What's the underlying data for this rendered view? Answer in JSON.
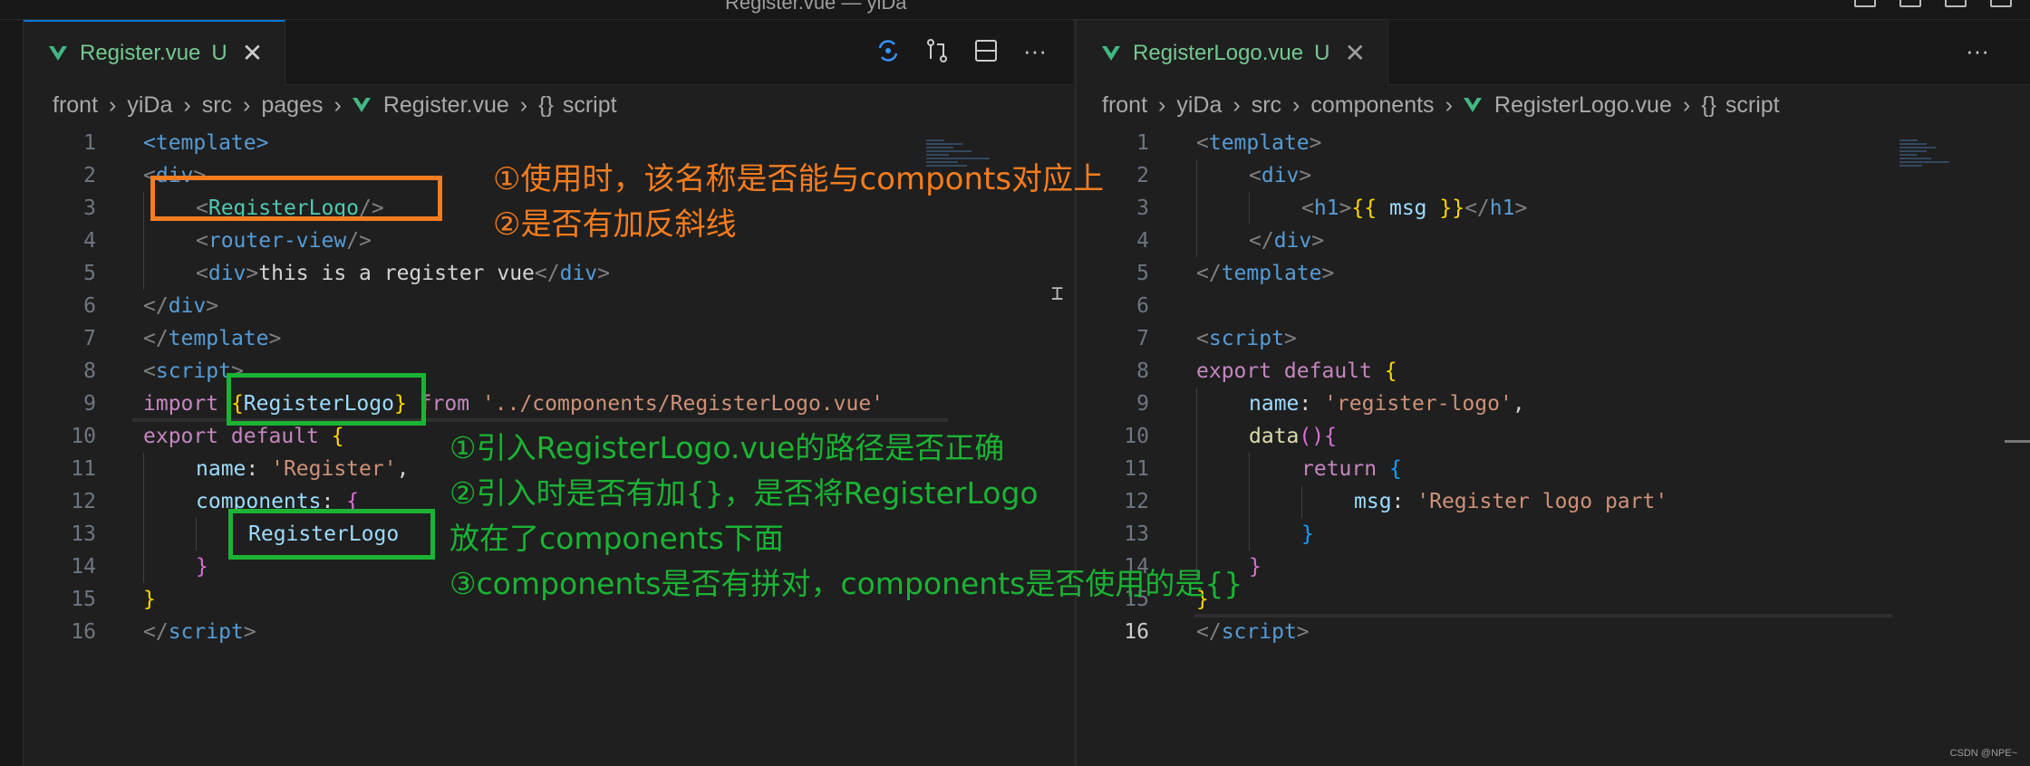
{
  "window": {
    "title": "Register.vue — yiDa"
  },
  "left": {
    "tab": {
      "name": "Register.vue",
      "status": "U"
    },
    "breadcrumb": [
      "front",
      "yiDa",
      "src",
      "pages",
      "Register.vue",
      "script"
    ],
    "toolbar": [
      "open-changes-icon",
      "compare-icon",
      "split-editor-icon",
      "more-actions-icon"
    ],
    "lines": [
      {
        "n": "1",
        "indent": 0,
        "t": [
          [
            "tag",
            "<template>"
          ]
        ]
      },
      {
        "n": "2",
        "indent": 0,
        "t": [
          [
            "pun",
            "<"
          ],
          [
            "tag",
            "div"
          ],
          [
            "pun",
            ">"
          ]
        ]
      },
      {
        "n": "3",
        "indent": 1,
        "t": [
          [
            "pun",
            "<"
          ],
          [
            "cmp",
            "RegisterLogo"
          ],
          [
            "pun",
            "/>"
          ]
        ]
      },
      {
        "n": "4",
        "indent": 1,
        "t": [
          [
            "pun",
            "<"
          ],
          [
            "tag",
            "router-view"
          ],
          [
            "pun",
            "/>"
          ]
        ]
      },
      {
        "n": "5",
        "indent": 1,
        "t": [
          [
            "pun",
            "<"
          ],
          [
            "tag",
            "div"
          ],
          [
            "pun",
            ">"
          ],
          [
            "plain",
            "this is a register vue"
          ],
          [
            "pun",
            "</"
          ],
          [
            "tag",
            "div"
          ],
          [
            "pun",
            ">"
          ]
        ]
      },
      {
        "n": "6",
        "indent": 0,
        "t": [
          [
            "pun",
            "</"
          ],
          [
            "tag",
            "div"
          ],
          [
            "pun",
            ">"
          ]
        ]
      },
      {
        "n": "7",
        "indent": 0,
        "t": [
          [
            "pun",
            "</"
          ],
          [
            "tag",
            "template"
          ],
          [
            "pun",
            ">"
          ]
        ]
      },
      {
        "n": "8",
        "indent": 0,
        "t": [
          [
            "pun",
            "<"
          ],
          [
            "tag",
            "script"
          ],
          [
            "pun",
            ">"
          ]
        ]
      },
      {
        "n": "9",
        "indent": 0,
        "t": [
          [
            "kw",
            "import "
          ],
          [
            "br1",
            "{"
          ],
          [
            "var",
            "RegisterLogo"
          ],
          [
            "br1",
            "}"
          ],
          [
            "kw",
            " from "
          ],
          [
            "str",
            "'../components/RegisterLogo.vue'"
          ]
        ]
      },
      {
        "n": "10",
        "indent": 0,
        "t": [
          [
            "kw",
            "export default "
          ],
          [
            "br1",
            "{"
          ]
        ]
      },
      {
        "n": "11",
        "indent": 1,
        "t": [
          [
            "var",
            "name"
          ],
          [
            "plain",
            ": "
          ],
          [
            "str",
            "'Register'"
          ],
          [
            "plain",
            ","
          ]
        ]
      },
      {
        "n": "12",
        "indent": 1,
        "t": [
          [
            "var",
            "components"
          ],
          [
            "plain",
            ": "
          ],
          [
            "br2",
            "{"
          ]
        ]
      },
      {
        "n": "13",
        "indent": 2,
        "t": [
          [
            "var",
            "RegisterLogo"
          ]
        ]
      },
      {
        "n": "14",
        "indent": 1,
        "t": [
          [
            "br2",
            "}"
          ]
        ]
      },
      {
        "n": "15",
        "indent": 0,
        "t": [
          [
            "br1",
            "}"
          ]
        ]
      },
      {
        "n": "16",
        "indent": 0,
        "t": [
          [
            "pun",
            "</"
          ],
          [
            "tag",
            "script"
          ],
          [
            "pun",
            ">"
          ]
        ]
      }
    ]
  },
  "right": {
    "tab": {
      "name": "RegisterLogo.vue",
      "status": "U"
    },
    "breadcrumb": [
      "front",
      "yiDa",
      "src",
      "components",
      "RegisterLogo.vue",
      "script"
    ],
    "lines": [
      {
        "n": "1",
        "indent": 0,
        "t": [
          [
            "pun",
            "<"
          ],
          [
            "tag",
            "template"
          ],
          [
            "pun",
            ">"
          ]
        ]
      },
      {
        "n": "2",
        "indent": 1,
        "t": [
          [
            "pun",
            "<"
          ],
          [
            "tag",
            "div"
          ],
          [
            "pun",
            ">"
          ]
        ]
      },
      {
        "n": "3",
        "indent": 2,
        "t": [
          [
            "pun",
            "<"
          ],
          [
            "tag",
            "h1"
          ],
          [
            "pun",
            ">"
          ],
          [
            "br1",
            "{{ "
          ],
          [
            "var",
            "msg"
          ],
          [
            "br1",
            " }}"
          ],
          [
            "pun",
            "</"
          ],
          [
            "tag",
            "h1"
          ],
          [
            "pun",
            ">"
          ]
        ]
      },
      {
        "n": "4",
        "indent": 1,
        "t": [
          [
            "pun",
            "</"
          ],
          [
            "tag",
            "div"
          ],
          [
            "pun",
            ">"
          ]
        ]
      },
      {
        "n": "5",
        "indent": 0,
        "t": [
          [
            "pun",
            "</"
          ],
          [
            "tag",
            "template"
          ],
          [
            "pun",
            ">"
          ]
        ]
      },
      {
        "n": "6",
        "indent": 0,
        "t": []
      },
      {
        "n": "7",
        "indent": 0,
        "t": [
          [
            "pun",
            "<"
          ],
          [
            "tag",
            "script"
          ],
          [
            "pun",
            ">"
          ]
        ]
      },
      {
        "n": "8",
        "indent": 0,
        "t": [
          [
            "kw",
            "export default "
          ],
          [
            "br1",
            "{"
          ]
        ]
      },
      {
        "n": "9",
        "indent": 1,
        "t": [
          [
            "var",
            "name"
          ],
          [
            "plain",
            ": "
          ],
          [
            "str",
            "'register-logo'"
          ],
          [
            "plain",
            ","
          ]
        ]
      },
      {
        "n": "10",
        "indent": 1,
        "t": [
          [
            "fn",
            "data"
          ],
          [
            "br2",
            "()"
          ],
          [
            "br2",
            "{"
          ]
        ]
      },
      {
        "n": "11",
        "indent": 2,
        "t": [
          [
            "kw",
            "return "
          ],
          [
            "br3",
            "{"
          ]
        ]
      },
      {
        "n": "12",
        "indent": 3,
        "t": [
          [
            "var",
            "msg"
          ],
          [
            "plain",
            ": "
          ],
          [
            "str",
            "'Register logo part'"
          ]
        ]
      },
      {
        "n": "13",
        "indent": 2,
        "t": [
          [
            "br3",
            "}"
          ]
        ]
      },
      {
        "n": "14",
        "indent": 1,
        "t": [
          [
            "br2",
            "}"
          ]
        ]
      },
      {
        "n": "15",
        "indent": 0,
        "t": [
          [
            "br1",
            "}"
          ]
        ]
      },
      {
        "n": "16",
        "indent": 0,
        "t": [
          [
            "pun",
            "</"
          ],
          [
            "tag",
            "script"
          ],
          [
            "pun",
            ">"
          ]
        ]
      }
    ],
    "active_line": "16"
  },
  "annotations": {
    "orange_1": "①使用时，该名称是否能与componts对应上",
    "orange_2": "②是否有加反斜线",
    "green_1": "①引入RegisterLogo.vue的路径是否正确",
    "green_2": "②引入时是否有加{}，是否将RegisterLogo",
    "green_3": "放在了components下面",
    "green_4": "③components是否有拼对，components是否使用的是{}"
  },
  "watermark": "CSDN @NPE~",
  "colors": {
    "accent": "#0078d4",
    "vue": "#41b883",
    "annot_orange": "#f57c1f",
    "annot_green": "#1bb334"
  }
}
